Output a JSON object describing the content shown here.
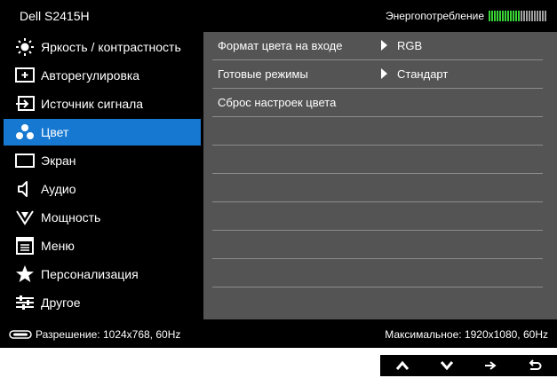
{
  "header": {
    "model": "Dell S2415H",
    "energy_label": "Энергопотребление",
    "energy_level": 0.55,
    "energy_on_color": "#38d438",
    "energy_off_color": "#a0a0a0"
  },
  "sidebar": {
    "items": [
      {
        "label": "Яркость / контрастность",
        "icon": "brightness-icon"
      },
      {
        "label": "Авторегулировка",
        "icon": "auto-adjust-icon"
      },
      {
        "label": "Источник сигнала",
        "icon": "input-source-icon"
      },
      {
        "label": "Цвет",
        "icon": "color-icon",
        "active": true
      },
      {
        "label": "Экран",
        "icon": "display-icon"
      },
      {
        "label": "Аудио",
        "icon": "audio-icon"
      },
      {
        "label": "Мощность",
        "icon": "power-icon"
      },
      {
        "label": "Меню",
        "icon": "menu-icon"
      },
      {
        "label": "Персонализация",
        "icon": "star-icon"
      },
      {
        "label": "Другое",
        "icon": "other-icon"
      }
    ],
    "active_color": "#1678d1"
  },
  "content": {
    "rows": [
      {
        "label": "Формат цвета на входе",
        "value": "RGB"
      },
      {
        "label": "Готовые режимы",
        "value": "Стандарт"
      },
      {
        "label": "Сброс настроек цвета",
        "value": ""
      }
    ],
    "empty_rows": 7
  },
  "status": {
    "resolution": "Разрешение: 1024x768, 60Hz",
    "max_resolution": "Максимальное: 1920x1080, 60Hz"
  },
  "nav_buttons": [
    {
      "name": "up-button",
      "icon": "chevron-up-icon"
    },
    {
      "name": "down-button",
      "icon": "chevron-down-icon"
    },
    {
      "name": "enter-button",
      "icon": "arrow-right-icon"
    },
    {
      "name": "back-button",
      "icon": "return-icon"
    }
  ]
}
